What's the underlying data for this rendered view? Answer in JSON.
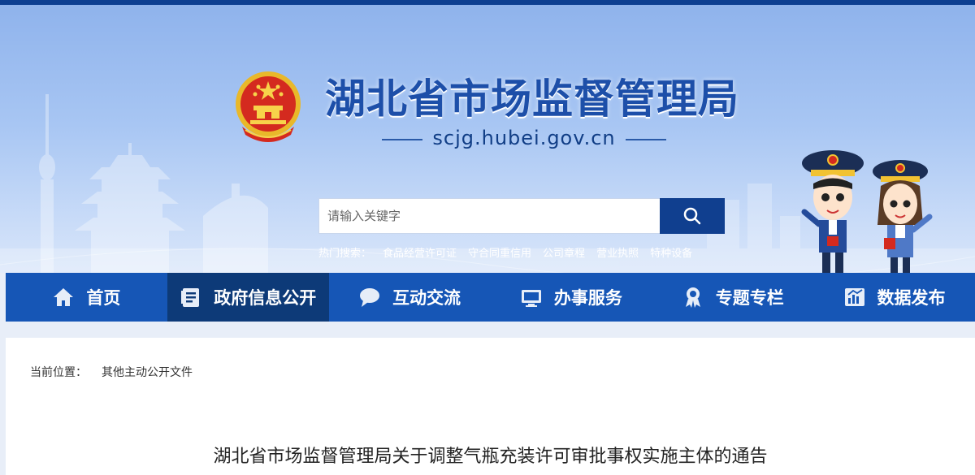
{
  "header": {
    "site_title": "湖北省市场监督管理局",
    "site_domain": "scjg.hubei.gov.cn"
  },
  "search": {
    "placeholder": "请输入关键字",
    "hot_label": "热门搜索：",
    "hot_terms": [
      "食品经营许可证",
      "守合同重信用",
      "公司章程",
      "营业执照",
      "特种设备"
    ]
  },
  "nav": {
    "items": [
      {
        "label": "首页",
        "icon": "home-icon"
      },
      {
        "label": "政府信息公开",
        "icon": "document-icon",
        "active": true
      },
      {
        "label": "互动交流",
        "icon": "chat-icon"
      },
      {
        "label": "办事服务",
        "icon": "monitor-icon"
      },
      {
        "label": "专题专栏",
        "icon": "ribbon-icon"
      },
      {
        "label": "数据发布",
        "icon": "chart-icon"
      }
    ]
  },
  "breadcrumb": {
    "label": "当前位置：",
    "current": "其他主动公开文件"
  },
  "article": {
    "title": "湖北省市场监督管理局关于调整气瓶充装许可审批事权实施主体的通告"
  },
  "colors": {
    "nav_bg": "#1656b6",
    "nav_active": "#0d3a78",
    "search_button": "#103f8f",
    "title_blue": "#1d4fa9"
  }
}
